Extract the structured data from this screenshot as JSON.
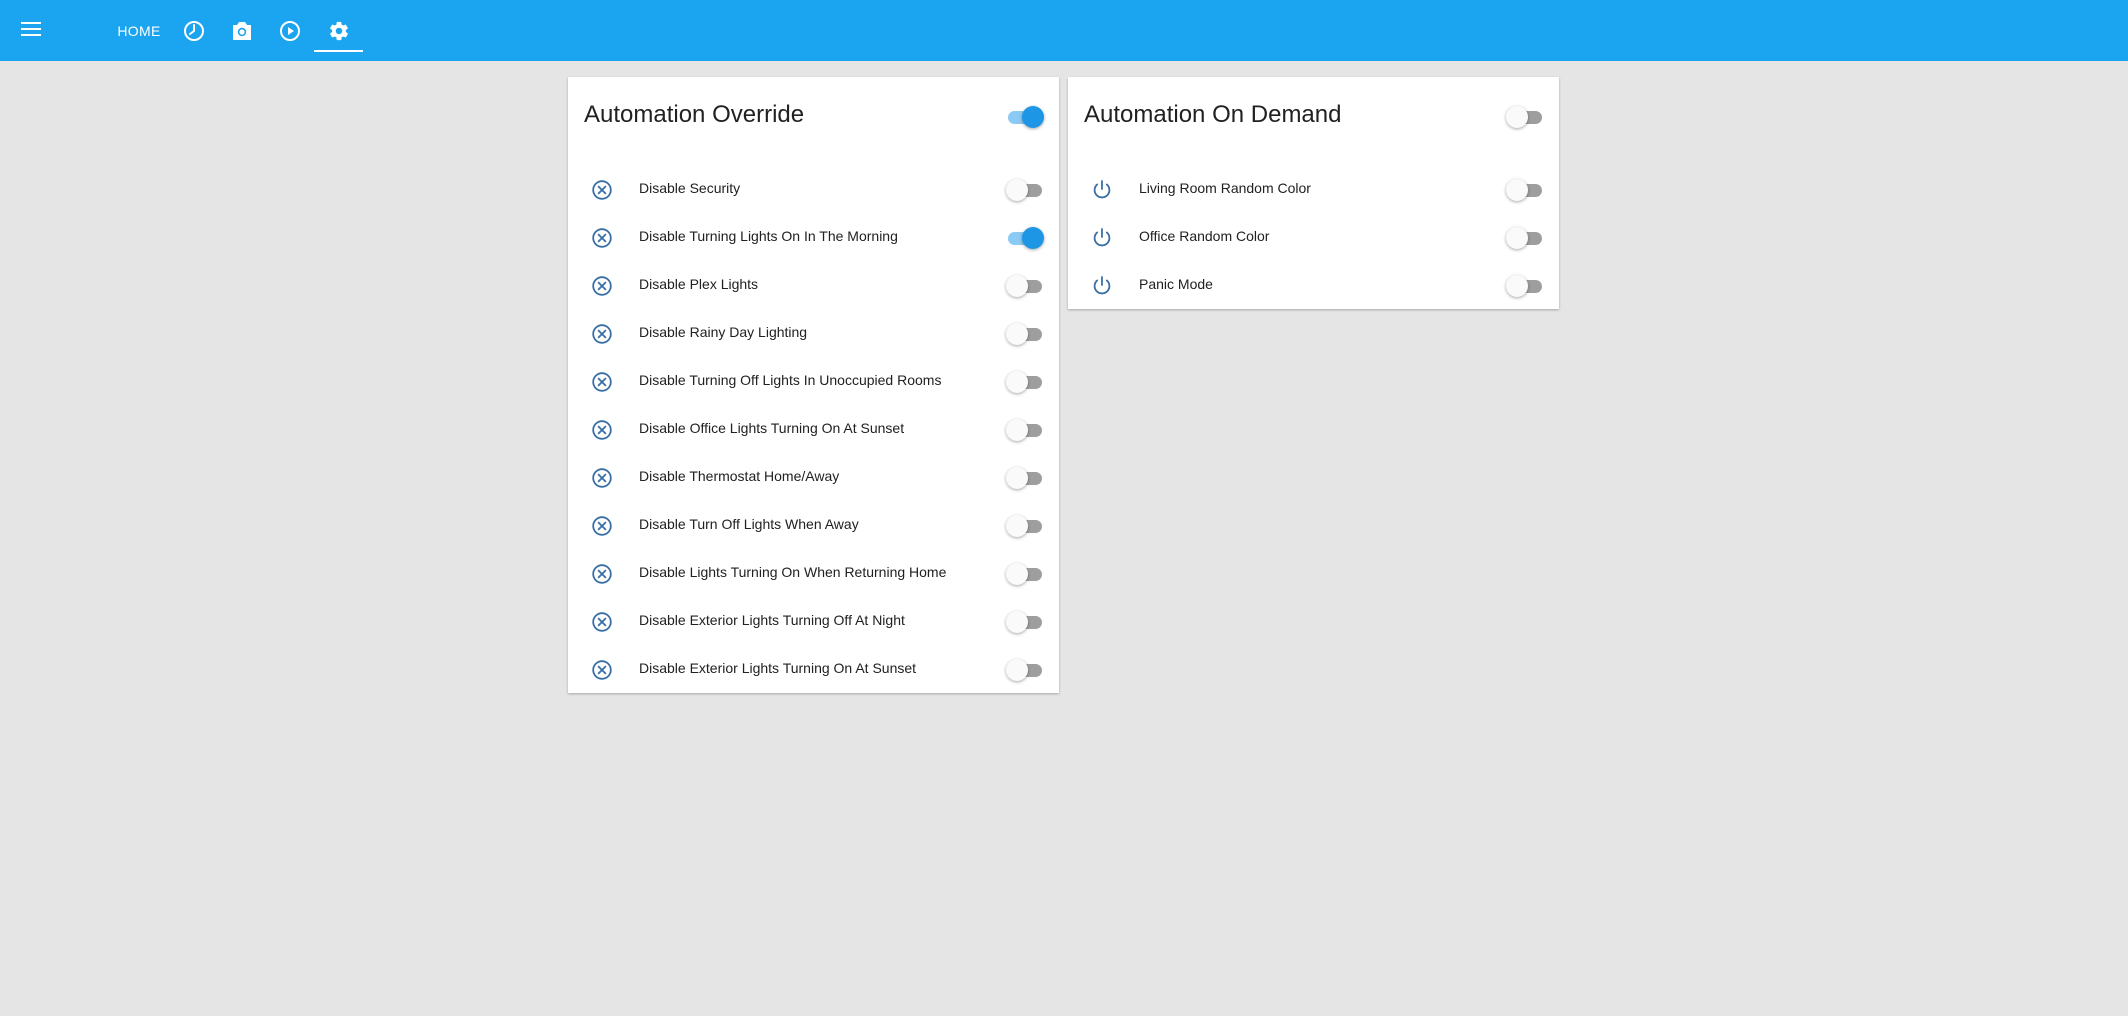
{
  "colors": {
    "toolbar": "#1ba4ef",
    "accent": "#1e96e6",
    "icon": "#3a6fa5",
    "background": "#e5e5e5"
  },
  "toolbar": {
    "menu_icon": "menu-icon",
    "home_label": "HOME",
    "tabs": [
      {
        "icon": "history-icon"
      },
      {
        "icon": "camera-icon"
      },
      {
        "icon": "play-icon"
      },
      {
        "icon": "settings-icon",
        "selected": true
      }
    ]
  },
  "override": {
    "title": "Automation Override",
    "master_on": true,
    "items": [
      {
        "label": "Disable Security",
        "on": false
      },
      {
        "label": "Disable Turning Lights On In The Morning",
        "on": true
      },
      {
        "label": "Disable Plex Lights",
        "on": false
      },
      {
        "label": "Disable Rainy Day Lighting",
        "on": false
      },
      {
        "label": "Disable Turning Off Lights In Unoccupied Rooms",
        "on": false
      },
      {
        "label": "Disable Office Lights Turning On At Sunset",
        "on": false
      },
      {
        "label": "Disable Thermostat Home/Away",
        "on": false
      },
      {
        "label": "Disable Turn Off Lights When Away",
        "on": false
      },
      {
        "label": "Disable Lights Turning On When Returning Home",
        "on": false
      },
      {
        "label": "Disable Exterior Lights Turning Off At Night",
        "on": false
      },
      {
        "label": "Disable Exterior Lights Turning On At Sunset",
        "on": false
      }
    ]
  },
  "demand": {
    "title": "Automation On Demand",
    "master_on": false,
    "items": [
      {
        "label": "Living Room Random Color",
        "on": false
      },
      {
        "label": "Office Random Color",
        "on": false
      },
      {
        "label": "Panic Mode",
        "on": false
      }
    ]
  }
}
